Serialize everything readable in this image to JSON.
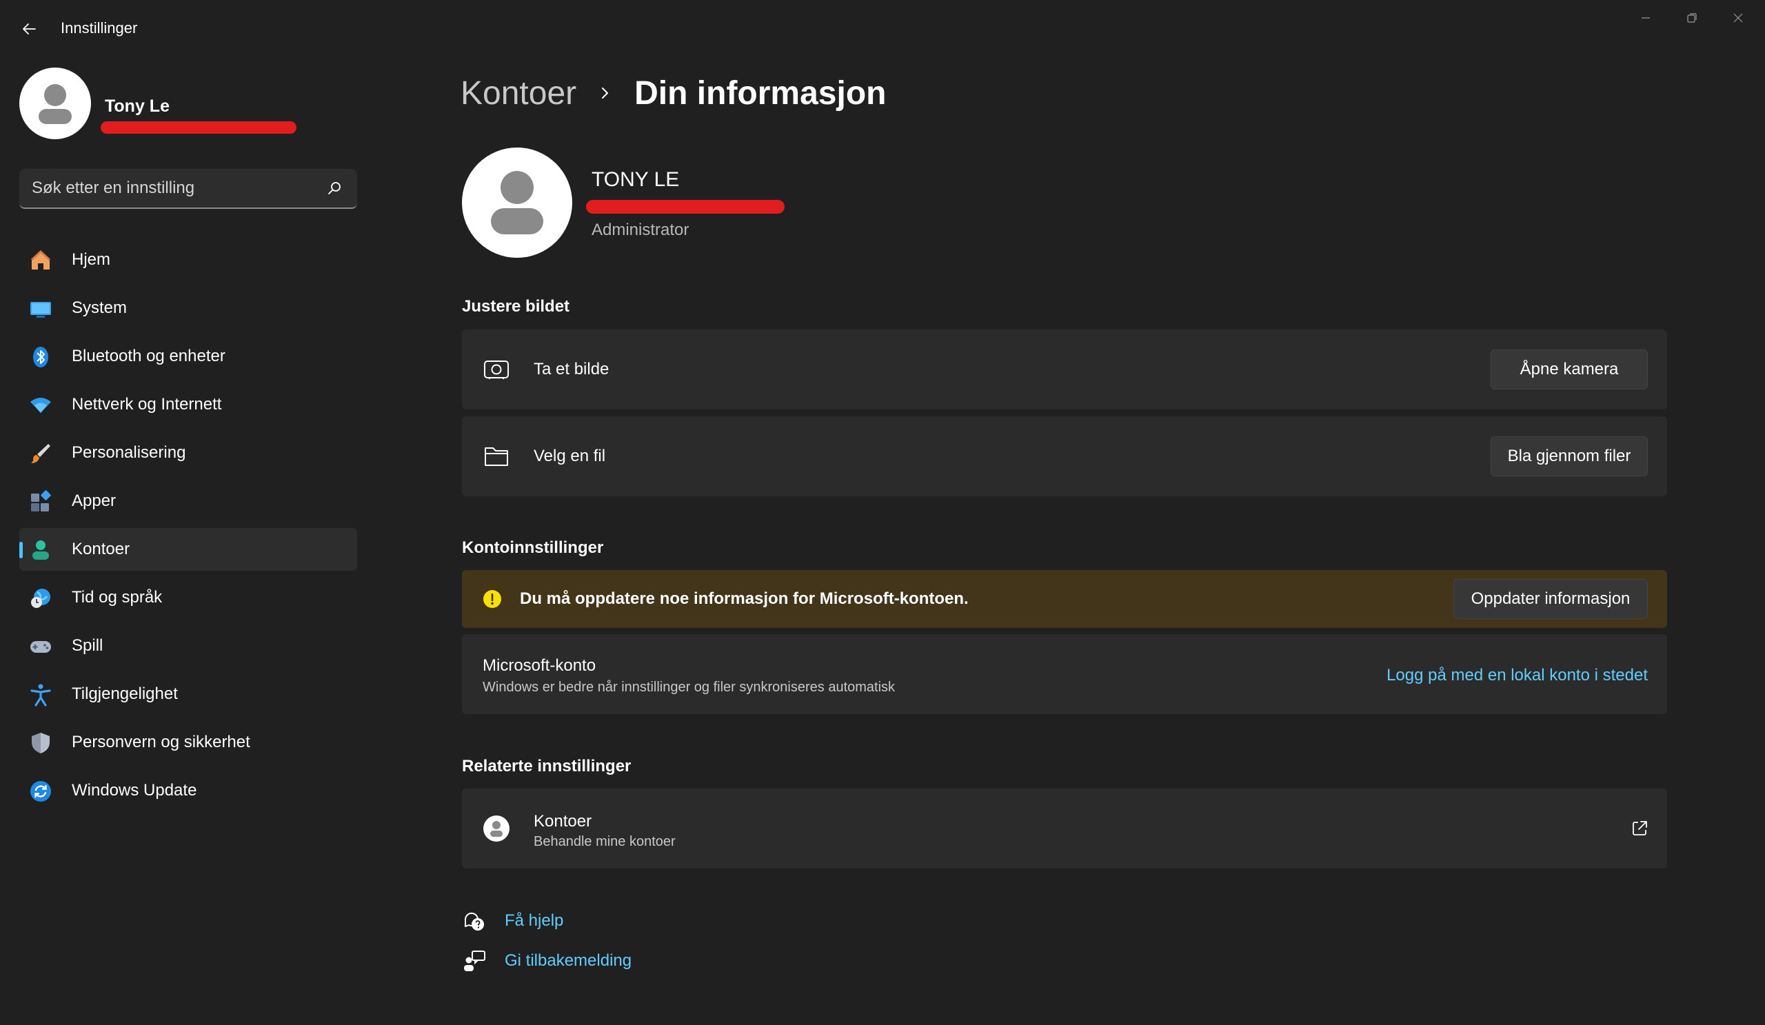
{
  "window": {
    "title": "Innstillinger",
    "back_icon": "back-arrow-icon",
    "controls": [
      "minimize-icon",
      "maximize-icon",
      "close-icon"
    ]
  },
  "sidebar": {
    "user": {
      "name": "Tony Le",
      "email_redacted": true
    },
    "search": {
      "placeholder": "Søk etter en innstilling",
      "value": ""
    },
    "items": [
      {
        "label": "Hjem",
        "icon": "home-icon",
        "active": false
      },
      {
        "label": "System",
        "icon": "system-display-icon",
        "active": false
      },
      {
        "label": "Bluetooth og enheter",
        "icon": "bluetooth-icon",
        "active": false
      },
      {
        "label": "Nettverk og Internett",
        "icon": "wifi-icon",
        "active": false
      },
      {
        "label": "Personalisering",
        "icon": "paintbrush-icon",
        "active": false
      },
      {
        "label": "Apper",
        "icon": "apps-icon",
        "active": false
      },
      {
        "label": "Kontoer",
        "icon": "accounts-icon",
        "active": true
      },
      {
        "label": "Tid og språk",
        "icon": "time-language-icon",
        "active": false
      },
      {
        "label": "Spill",
        "icon": "gamepad-icon",
        "active": false
      },
      {
        "label": "Tilgjengelighet",
        "icon": "accessibility-icon",
        "active": false
      },
      {
        "label": "Personvern og sikkerhet",
        "icon": "shield-icon",
        "active": false
      },
      {
        "label": "Windows Update",
        "icon": "windows-update-icon",
        "active": false
      }
    ]
  },
  "main": {
    "breadcrumb": {
      "parent": "Kontoer",
      "current": "Din informasjon"
    },
    "profile": {
      "name": "TONY LE",
      "email_redacted": true,
      "role": "Administrator"
    },
    "adjust_picture": {
      "title": "Justere bildet",
      "take_photo": {
        "label": "Ta et bilde",
        "button": "Åpne kamera",
        "icon": "camera-icon"
      },
      "choose_file": {
        "label": "Velg en fil",
        "button": "Bla gjennom filer",
        "icon": "folder-icon"
      }
    },
    "account_settings": {
      "title": "Kontoinnstillinger",
      "warning": {
        "text": "Du må oppdatere noe informasjon for Microsoft-kontoen.",
        "button": "Oppdater informasjon",
        "icon": "warning-icon"
      },
      "microsoft_account": {
        "title": "Microsoft-konto",
        "subtitle": "Windows er bedre når innstillinger og filer synkroniseres automatisk",
        "link": "Logg på med en lokal konto i stedet"
      }
    },
    "related": {
      "title": "Relaterte innstillinger",
      "accounts": {
        "title": "Kontoer",
        "subtitle": "Behandle mine kontoer",
        "icon": "account-circle-icon",
        "action_icon": "external-link-icon"
      }
    },
    "footer": {
      "help": {
        "label": "Få hjelp",
        "icon": "help-chat-icon"
      },
      "feedback": {
        "label": "Gi tilbakemelding",
        "icon": "feedback-icon"
      }
    }
  },
  "colors": {
    "background": "#202020",
    "card": "#2b2b2b",
    "accent": "#4cc2ff",
    "link": "#60cdff",
    "warning_bg": "#433519",
    "warning_icon": "#fce100",
    "redaction": "#e11d1d"
  }
}
